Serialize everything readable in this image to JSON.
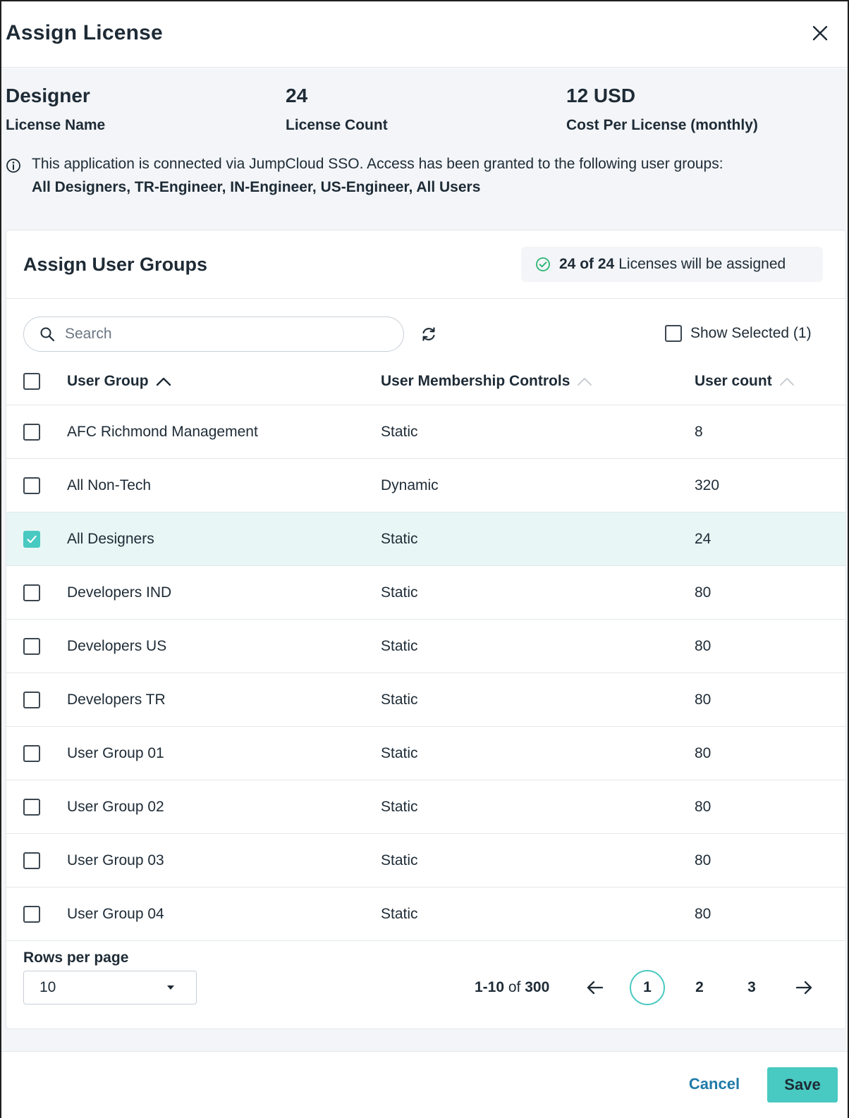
{
  "modal": {
    "title": "Assign License",
    "close_icon": "close-icon"
  },
  "license": {
    "name_value": "Designer",
    "name_label": "License Name",
    "count_value": "24",
    "count_label": "License Count",
    "cost_value": "12 USD",
    "cost_label": "Cost Per License (monthly)"
  },
  "notice": {
    "icon": "info-icon",
    "text": "This application is connected via JumpCloud SSO. Access has been granted to the following user groups:",
    "groups": "All Designers, TR-Engineer, IN-Engineer, US-Engineer, All Users"
  },
  "card": {
    "title": "Assign User Groups",
    "badge_icon": "check-circle-icon",
    "badge_strong": "24 of 24",
    "badge_rest": "Licenses will be assigned"
  },
  "toolbar": {
    "search_placeholder": "Search",
    "search_icon": "search-icon",
    "refresh_icon": "refresh-icon",
    "show_selected_label": "Show Selected (1)"
  },
  "table": {
    "headers": {
      "group": "User Group",
      "controls": "User Membership Controls",
      "count": "User count"
    },
    "rows": [
      {
        "group": "AFC Richmond Management",
        "controls": "Static",
        "count": "8",
        "checked": false
      },
      {
        "group": "All Non-Tech",
        "controls": "Dynamic",
        "count": "320",
        "checked": false
      },
      {
        "group": "All Designers",
        "controls": "Static",
        "count": "24",
        "checked": true
      },
      {
        "group": "Developers IND",
        "controls": "Static",
        "count": "80",
        "checked": false
      },
      {
        "group": "Developers US",
        "controls": "Static",
        "count": "80",
        "checked": false
      },
      {
        "group": "Developers TR",
        "controls": "Static",
        "count": "80",
        "checked": false
      },
      {
        "group": "User Group 01",
        "controls": "Static",
        "count": "80",
        "checked": false
      },
      {
        "group": "User Group 02",
        "controls": "Static",
        "count": "80",
        "checked": false
      },
      {
        "group": "User Group 03",
        "controls": "Static",
        "count": "80",
        "checked": false
      },
      {
        "group": "User Group 04",
        "controls": "Static",
        "count": "80",
        "checked": false
      }
    ]
  },
  "pagination": {
    "rows_per_page_label": "Rows per page",
    "rows_per_page_value": "10",
    "range": "1-10",
    "of_word": "of",
    "total": "300",
    "pages": [
      "1",
      "2",
      "3"
    ],
    "active_page": "1"
  },
  "footer": {
    "cancel_label": "Cancel",
    "save_label": "Save"
  },
  "colors": {
    "accent": "#48c9c1",
    "selected_row": "#e8f6f5",
    "link": "#1f7aa8",
    "text": "#1e2b36",
    "info_bg": "#f3f5f8"
  }
}
